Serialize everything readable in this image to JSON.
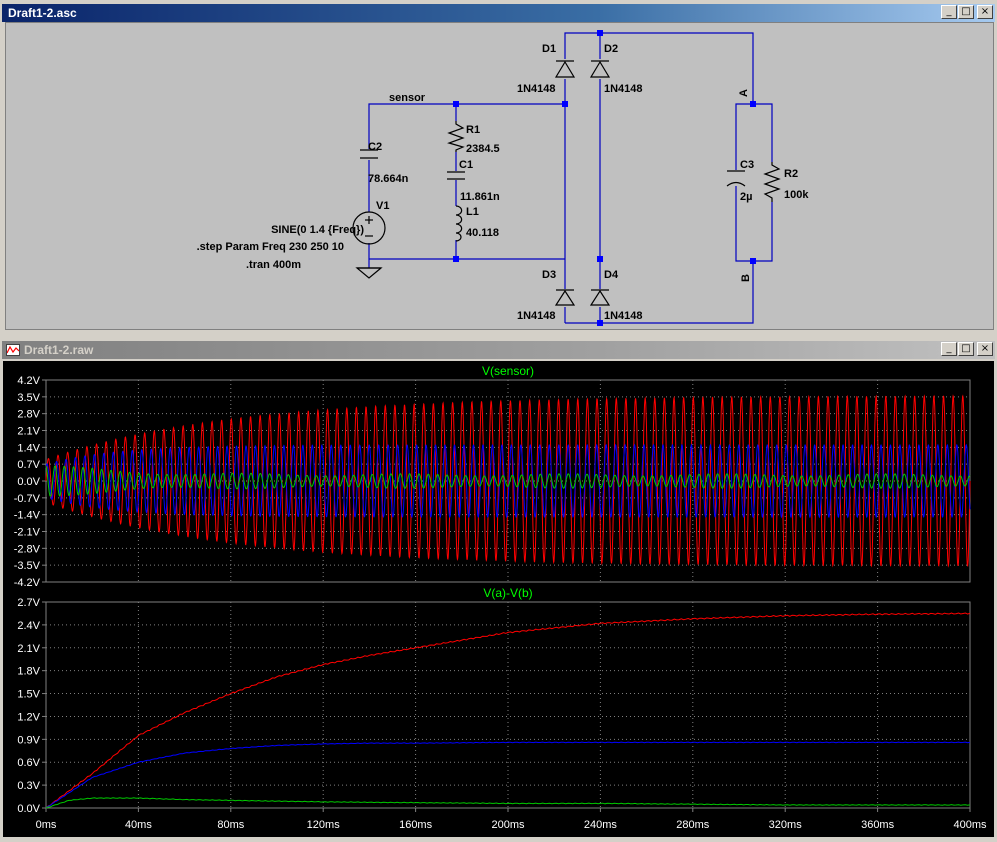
{
  "schematic_window": {
    "title": "Draft1-2.asc",
    "buttons": {
      "minimize": "_",
      "maximize": "□",
      "close": "×"
    }
  },
  "schematic": {
    "net_labels": {
      "sensor": "sensor",
      "a": "A",
      "b": "B"
    },
    "components": {
      "D1": {
        "name": "D1",
        "model": "1N4148"
      },
      "D2": {
        "name": "D2",
        "model": "1N4148"
      },
      "D3": {
        "name": "D3",
        "model": "1N4148"
      },
      "D4": {
        "name": "D4",
        "model": "1N4148"
      },
      "R1": {
        "name": "R1",
        "value": "2384.5"
      },
      "C1": {
        "name": "C1",
        "value": "11.861n"
      },
      "L1": {
        "name": "L1",
        "value": "40.118"
      },
      "C2": {
        "name": "C2",
        "value": "78.664n"
      },
      "V1": {
        "name": "V1",
        "value": "SINE(0 1.4 {Freq})"
      },
      "C3": {
        "name": "C3",
        "value": "2µ"
      },
      "R2": {
        "name": "R2",
        "value": "100k"
      }
    },
    "directives": {
      "step": ".step Param Freq 230 250 10",
      "tran": ".tran 400m"
    }
  },
  "waveform_window": {
    "title": "Draft1-2.raw",
    "buttons": {
      "minimize": "_",
      "maximize": "□",
      "close": "×"
    }
  },
  "colors": {
    "red": "#ff0000",
    "blue": "#0000ff",
    "green": "#00c800",
    "grid": "#808080",
    "axis_text": "#ffffff",
    "trace_title": "#00ff00"
  },
  "chart_data": [
    {
      "type": "line",
      "title": "V(sensor)",
      "xlabel": "",
      "ylabel": "",
      "xlim": [
        0,
        400
      ],
      "ylim": [
        -4.2,
        4.2
      ],
      "x_tick_labels": [],
      "y_tick_labels": [
        "4.2V",
        "3.5V",
        "2.8V",
        "2.1V",
        "1.4V",
        "0.7V",
        "0.0V",
        "-0.7V",
        "-1.4V",
        "-2.1V",
        "-2.8V",
        "-3.5V",
        "-4.2V"
      ],
      "grid": true,
      "series": [
        {
          "color": "red",
          "envelope_amplitude_start": 0.9,
          "envelope_amplitude_end": 3.55,
          "time_constant_ms": 80
        },
        {
          "color": "blue",
          "envelope_amplitude_start": 0.7,
          "envelope_amplitude_end": 1.5,
          "time_constant_ms": 30
        },
        {
          "color": "green",
          "envelope_amplitude_start": 0.75,
          "envelope_amplitude_end": 0.3,
          "time_constant_ms": 30
        }
      ]
    },
    {
      "type": "line",
      "title": "V(a)-V(b)",
      "xlabel": "",
      "ylabel": "",
      "xlim": [
        0,
        400
      ],
      "ylim": [
        0,
        2.7
      ],
      "x_tick_labels": [
        "0ms",
        "40ms",
        "80ms",
        "120ms",
        "160ms",
        "200ms",
        "240ms",
        "280ms",
        "320ms",
        "360ms",
        "400ms"
      ],
      "y_tick_labels": [
        "2.7V",
        "2.4V",
        "2.1V",
        "1.8V",
        "1.5V",
        "1.2V",
        "0.9V",
        "0.6V",
        "0.3V",
        "0.0V"
      ],
      "grid": true,
      "series": [
        {
          "color": "red",
          "x": [
            0,
            20,
            40,
            60,
            80,
            100,
            120,
            140,
            160,
            180,
            200,
            240,
            280,
            320,
            360,
            400
          ],
          "values": [
            0,
            0.45,
            0.95,
            1.25,
            1.5,
            1.72,
            1.88,
            2.0,
            2.1,
            2.2,
            2.3,
            2.42,
            2.48,
            2.52,
            2.54,
            2.55
          ]
        },
        {
          "color": "blue",
          "x": [
            0,
            20,
            40,
            60,
            80,
            100,
            120,
            140,
            160,
            200,
            240,
            280,
            320,
            360,
            400
          ],
          "values": [
            0,
            0.4,
            0.6,
            0.72,
            0.78,
            0.82,
            0.84,
            0.85,
            0.85,
            0.86,
            0.86,
            0.86,
            0.86,
            0.86,
            0.86
          ]
        },
        {
          "color": "green",
          "x": [
            0,
            10,
            20,
            40,
            60,
            80,
            100,
            120,
            160,
            200,
            240,
            280,
            320,
            360,
            400
          ],
          "values": [
            0,
            0.1,
            0.13,
            0.13,
            0.11,
            0.1,
            0.09,
            0.08,
            0.07,
            0.06,
            0.06,
            0.05,
            0.04,
            0.04,
            0.04
          ]
        }
      ]
    }
  ]
}
